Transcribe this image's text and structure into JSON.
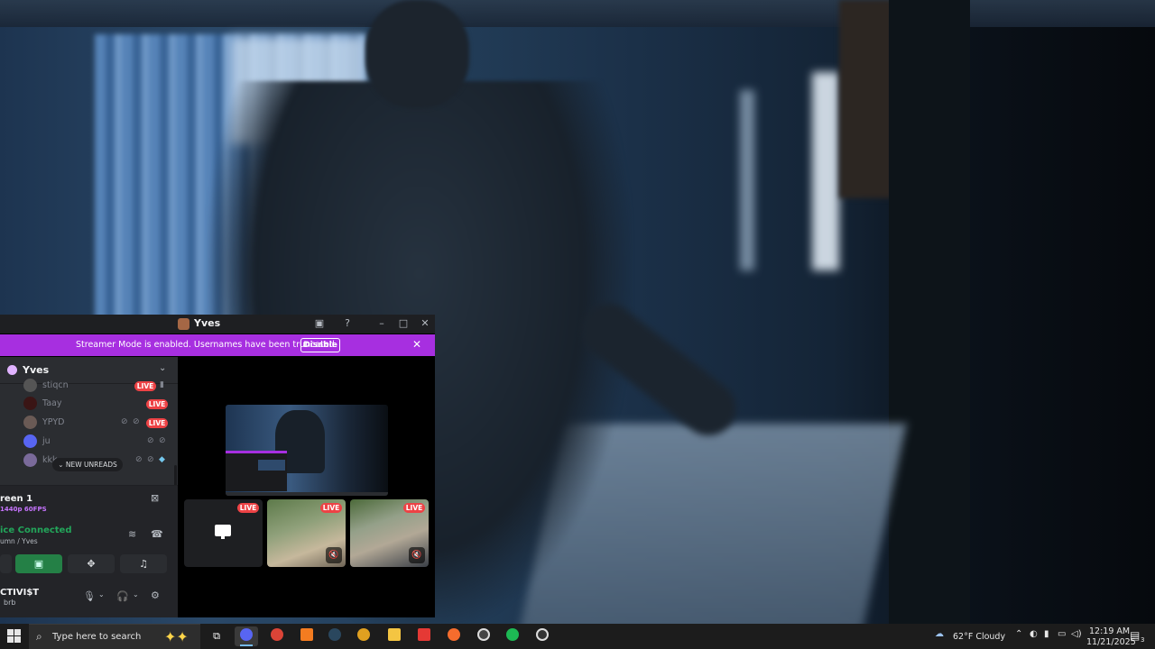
{
  "window": {
    "title": "Yves"
  },
  "banner": {
    "text": "Streamer Mode is enabled. Usernames have been truncated.",
    "button_label": "Disable"
  },
  "server": {
    "name": "Yves"
  },
  "voice_channel_users": [
    {
      "name": "stiqcn",
      "live": "LIVE"
    },
    {
      "name": "Taay",
      "live": "LIVE"
    },
    {
      "name": "YPYD",
      "live": "LIVE"
    },
    {
      "name": "ju",
      "live": ""
    },
    {
      "name": "kkk",
      "live": ""
    }
  ],
  "new_unreads_label": "NEW UNREADS",
  "rtc": {
    "screen_name": "reen 1",
    "screen_quality": "1440p 60FPS",
    "voice_status": "ice Connected",
    "voice_location": "umn / Yves"
  },
  "user_panel": {
    "username": "CTIVI$T",
    "status": "brb"
  },
  "stream_tiles": [
    {
      "live": "LIVE",
      "muted": false
    },
    {
      "live": "LIVE",
      "muted": true
    },
    {
      "live": "LIVE",
      "muted": true
    }
  ],
  "taskbar": {
    "search_placeholder": "Type here to search",
    "weather": "62°F  Cloudy",
    "time": "12:19 AM",
    "date": "11/21/2025",
    "notification_count": "3"
  },
  "colors": {
    "streamer_banner": "#a72fe0",
    "live_badge": "#ed4245",
    "voice_connected": "#23a55a",
    "sidebar_bg": "#2b2d31",
    "taskbar_bg": "#1c1c1c"
  }
}
